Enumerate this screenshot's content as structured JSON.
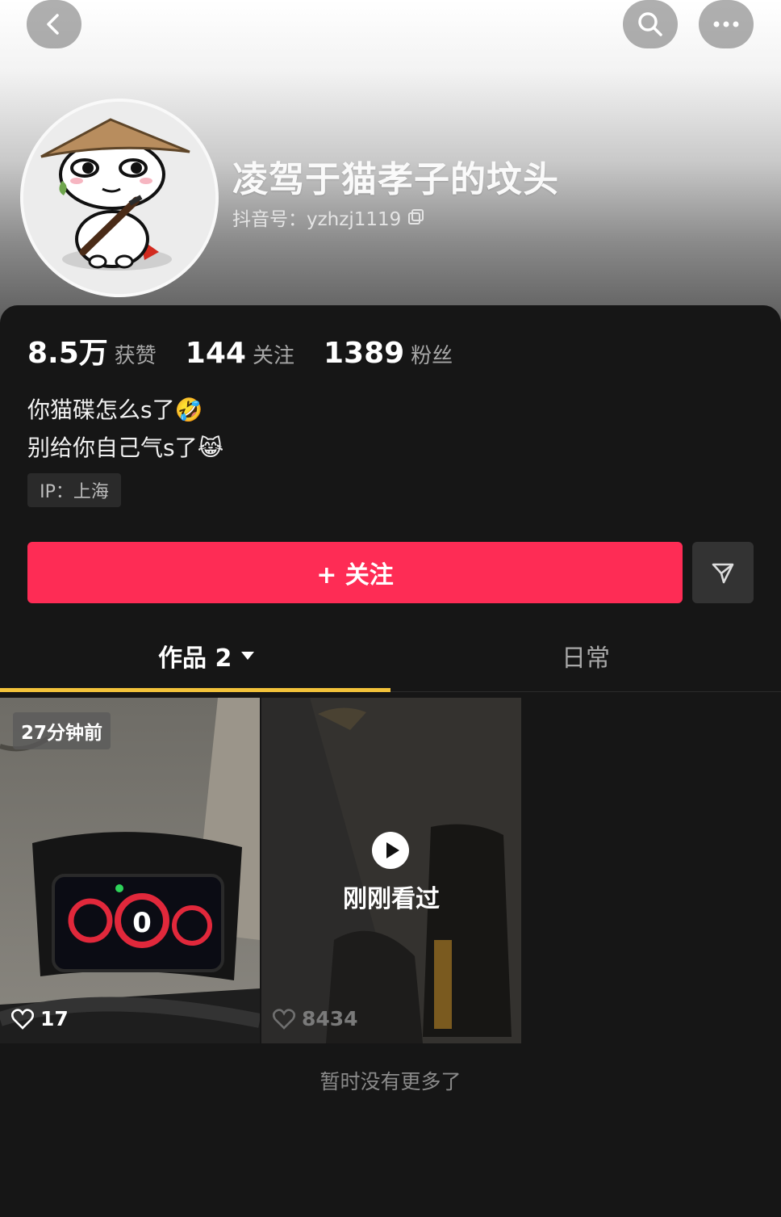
{
  "profile": {
    "name": "凌驾于猫孝子的坟头",
    "douyin_id": "抖音号：yzhzj1119",
    "stats": [
      {
        "value": "8.5万",
        "label": "获赞"
      },
      {
        "value": "144",
        "label": "关注"
      },
      {
        "value": "1389",
        "label": "粉丝"
      }
    ],
    "bio_line1": "你猫碟怎么s了🤣",
    "bio_line2": "别给你自己气s了😹",
    "ip": "IP：上海"
  },
  "actions": {
    "follow_label": "+ 关注"
  },
  "tabs": [
    {
      "label": "作品 2",
      "active": true
    },
    {
      "label": "日常",
      "active": false
    }
  ],
  "videos": [
    {
      "badge": "27分钟前",
      "likes": "17"
    },
    {
      "overlay": "刚刚看过",
      "likes": "8434"
    }
  ],
  "footer": {
    "end_text": "暂时没有更多了"
  },
  "colors": {
    "accent": "#fe2c55",
    "tab_indicator": "#f2c23a",
    "background": "#161616"
  },
  "icons": [
    "back-icon",
    "search-icon",
    "more-icon",
    "copy-icon",
    "share-icon",
    "chevron-down-icon",
    "heart-icon",
    "play-icon"
  ]
}
